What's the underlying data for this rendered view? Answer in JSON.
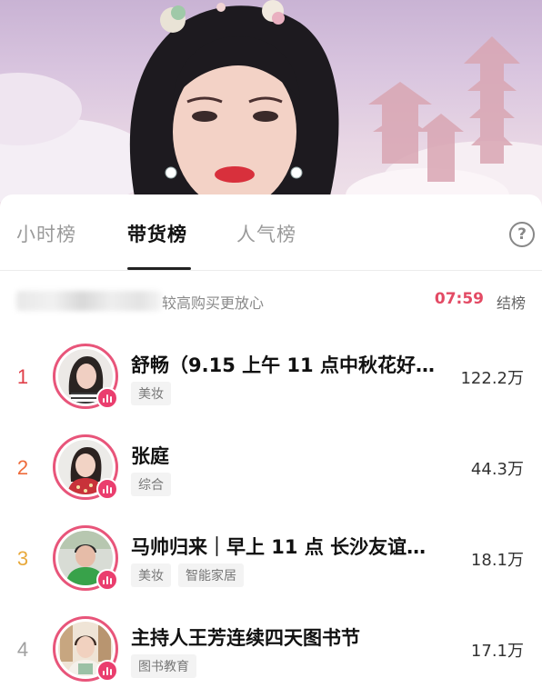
{
  "tabs": [
    {
      "label": "小时榜",
      "active": false
    },
    {
      "label": "带货榜",
      "active": true
    },
    {
      "label": "人气榜",
      "active": false
    }
  ],
  "help_icon": "question-circle-icon",
  "notice": {
    "text": "较高购买更放心",
    "countdown": "07:59",
    "countdown_label": "结榜"
  },
  "colors": {
    "accent": "#e34a64",
    "rank1": "#e0404a",
    "rank2": "#ee6b3b",
    "rank3": "#e8a93c",
    "rank4": "#a0a0a0",
    "avatar_ring": "#e8557a"
  },
  "rankings": [
    {
      "rank": "1",
      "name": "舒畅（9.15 上午 11 点中秋花好…",
      "tags": [
        "美妆"
      ],
      "sales": "122.2万"
    },
    {
      "rank": "2",
      "name": "张庭",
      "tags": [
        "综合"
      ],
      "sales": "44.3万"
    },
    {
      "rank": "3",
      "name": "马帅归来｜早上 11 点 长沙友谊…",
      "tags": [
        "美妆",
        "智能家居"
      ],
      "sales": "18.1万"
    },
    {
      "rank": "4",
      "name": "主持人王芳连续四天图书节",
      "tags": [
        "图书教育"
      ],
      "sales": "17.1万"
    }
  ]
}
